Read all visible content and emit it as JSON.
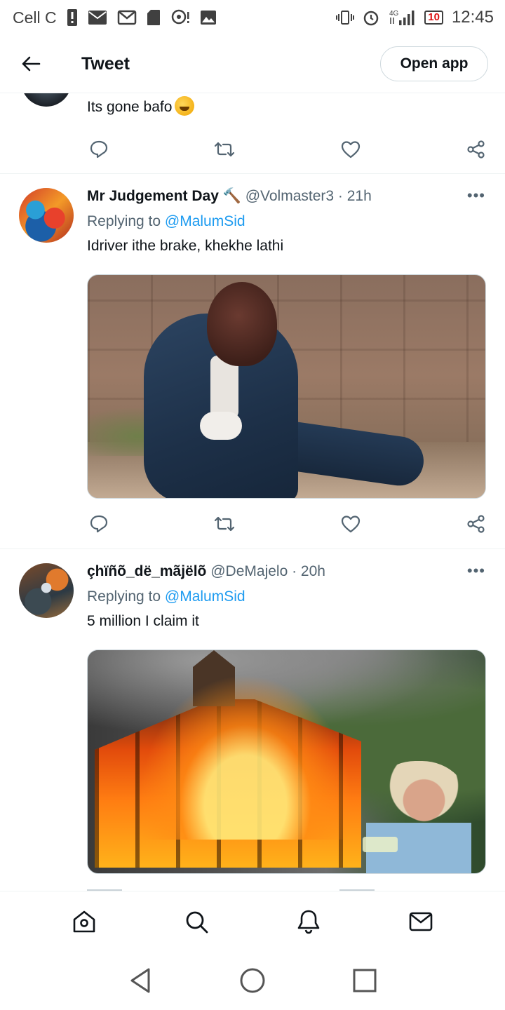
{
  "status_bar": {
    "carrier": "Cell C",
    "time": "12:45",
    "battery": "10",
    "network": "4G",
    "icons_left": [
      "sim-alert-icon",
      "mail-icon",
      "gmail-icon",
      "sd-card-icon",
      "hotspot-icon",
      "gallery-icon"
    ],
    "icons_right": [
      "vibrate-icon",
      "alarm-icon",
      "signal-icon",
      "battery-icon"
    ]
  },
  "header": {
    "title": "Tweet",
    "open_app_label": "Open app"
  },
  "partial_tweet": {
    "text": "Its gone bafo"
  },
  "tweets": [
    {
      "display_name": "Mr Judgement Day 🔨",
      "handle": "@Volmaster3",
      "time": "21h",
      "meta": "@Volmaster3 · 21h",
      "replying_prefix": "Replying to",
      "replying_to": "@MalumSid",
      "text": "Idriver ithe brake, khekhe lathi"
    },
    {
      "display_name": "çhïñõ_dë_mãjëlõ",
      "handle": "@DeMajelo",
      "time": "20h",
      "meta": "@DeMajelo · 20h",
      "replying_prefix": "Replying to",
      "replying_to": "@MalumSid",
      "text": "5 million I claim it"
    }
  ],
  "more_label": "•••",
  "bottom_nav": [
    "home-icon",
    "search-icon",
    "notifications-icon",
    "messages-icon"
  ],
  "system_nav": [
    "back-icon",
    "home-circle-icon",
    "recents-icon"
  ],
  "colors": {
    "accent": "#1d9bf0",
    "text": "#0f1419",
    "muted": "#536471",
    "divider": "#eff3f4"
  }
}
